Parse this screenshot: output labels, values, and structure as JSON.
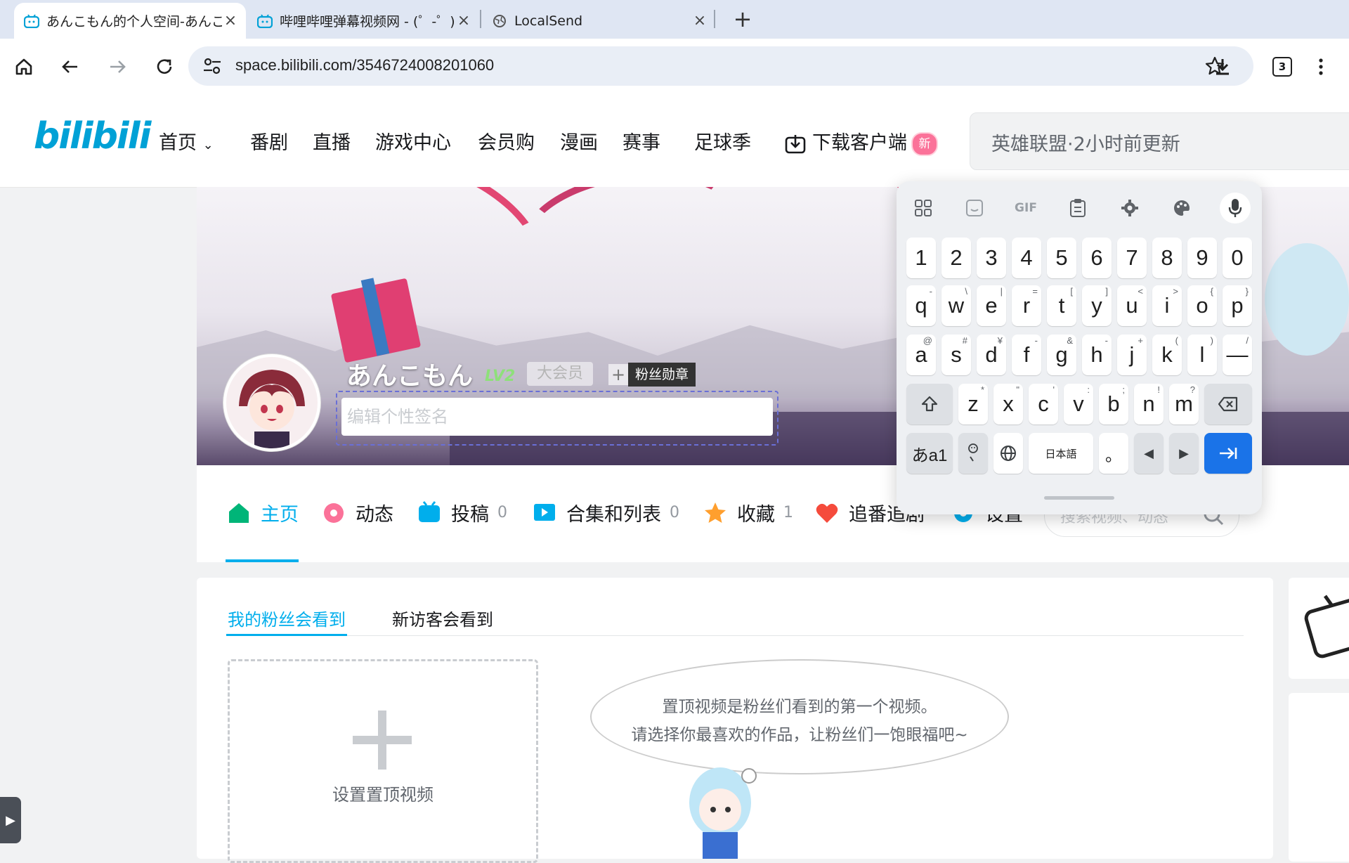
{
  "browser": {
    "tabs": [
      {
        "title": "あんこもん的个人空间-あんこもん",
        "active": true
      },
      {
        "title": "哔哩哔哩弹幕视频网 - (゜-゜)つロ",
        "active": false
      },
      {
        "title": "LocalSend",
        "active": false
      }
    ],
    "url": "space.bilibili.com/3546724008201060",
    "extensions_count": "3"
  },
  "site": {
    "logo": "bilibili",
    "nav": [
      "首页",
      "番剧",
      "直播",
      "游戏中心",
      "会员购",
      "漫画",
      "赛事",
      "足球季"
    ],
    "download_label": "下载客户端",
    "download_badge": "新",
    "search_placeholder": "英雄联盟·2小时前更新"
  },
  "profile": {
    "username": "あんこもん",
    "level": "LV2",
    "vip_label": "大会员",
    "fan_medal_label": "粉丝勋章",
    "sign_placeholder": "编辑个性签名"
  },
  "profile_nav": [
    {
      "label": "主页",
      "count": "",
      "active": true
    },
    {
      "label": "动态",
      "count": ""
    },
    {
      "label": "投稿",
      "count": "0"
    },
    {
      "label": "合集和列表",
      "count": "0"
    },
    {
      "label": "收藏",
      "count": "1"
    },
    {
      "label": "追番追剧",
      "count": ""
    },
    {
      "label": "设置",
      "count": ""
    }
  ],
  "profile_search_placeholder": "搜索视频、动态",
  "content": {
    "tabs": [
      "我的粉丝会看到",
      "新访客会看到"
    ],
    "upload_label": "设置置顶视频",
    "bubble_line1": "置顶视频是粉丝们看到的第一个视频。",
    "bubble_line2": "请选择你最喜欢的作品，让粉丝们一饱眼福吧~"
  },
  "keyboard": {
    "toolbar": [
      "apps",
      "sticker",
      "GIF",
      "clipboard",
      "settings",
      "theme",
      "mic"
    ],
    "row_numbers": [
      "1",
      "2",
      "3",
      "4",
      "5",
      "6",
      "7",
      "8",
      "9",
      "0"
    ],
    "row_q": [
      [
        "q",
        "-"
      ],
      [
        "w",
        "\\"
      ],
      [
        "e",
        "|"
      ],
      [
        "r",
        "="
      ],
      [
        "t",
        "["
      ],
      [
        "y",
        "]"
      ],
      [
        "u",
        "<"
      ],
      [
        "i",
        ">"
      ],
      [
        "o",
        "{"
      ],
      [
        "p",
        "}"
      ]
    ],
    "row_a": [
      [
        "a",
        "@"
      ],
      [
        "s",
        "#"
      ],
      [
        "d",
        "¥"
      ],
      [
        "f",
        "-"
      ],
      [
        "g",
        "&"
      ],
      [
        "h",
        "-"
      ],
      [
        "j",
        "+"
      ],
      [
        "k",
        "("
      ],
      [
        "l",
        ")"
      ],
      [
        "—",
        "/"
      ]
    ],
    "row_z": [
      [
        "z",
        "*"
      ],
      [
        "x",
        "\""
      ],
      [
        "c",
        "'"
      ],
      [
        "v",
        ":"
      ],
      [
        "b",
        ";"
      ],
      [
        "n",
        "!"
      ],
      [
        "m",
        "?"
      ]
    ],
    "mode_key": "あa1",
    "lang_key": "日本語",
    "period_key": "。"
  }
}
